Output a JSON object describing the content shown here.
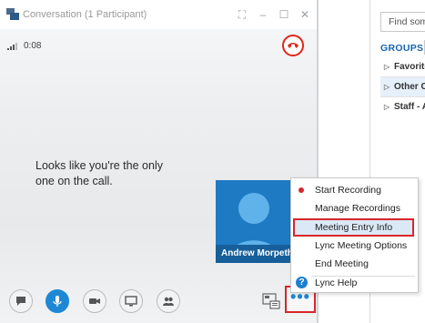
{
  "window": {
    "title": "Conversation (1 Participant)",
    "call_duration": "0:08"
  },
  "stage": {
    "message": "Looks like you're the only one on the call."
  },
  "participant": {
    "name": "Andrew Morpeth",
    "tile_color": "#1f7ac4"
  },
  "more_menu": {
    "items": [
      {
        "label": "Start Recording",
        "icon": "record-dot-icon"
      },
      {
        "label": "Manage Recordings",
        "icon": ""
      },
      {
        "label": "Meeting Entry Info",
        "icon": "",
        "highlighted": true
      },
      {
        "label": "Lync Meeting Options",
        "icon": ""
      },
      {
        "label": "End Meeting",
        "icon": ""
      },
      {
        "label": "Lync Help",
        "icon": "help-icon"
      }
    ],
    "help_glyph": "?"
  },
  "toolbar": {
    "more_label": "•••",
    "buttons": [
      "im-icon",
      "microphone-icon",
      "video-icon",
      "present-icon",
      "participants-icon"
    ]
  },
  "contacts": {
    "search_placeholder": "Find someone",
    "groups_label": "GROUPS",
    "groups": [
      "Favorites",
      "Other Contacts",
      "Staff - All"
    ]
  },
  "colors": {
    "accent": "#1e88d6",
    "highlight_border": "#d7262b",
    "hangup": "#e0261b",
    "menu_highlight": "#dbe9f7"
  }
}
